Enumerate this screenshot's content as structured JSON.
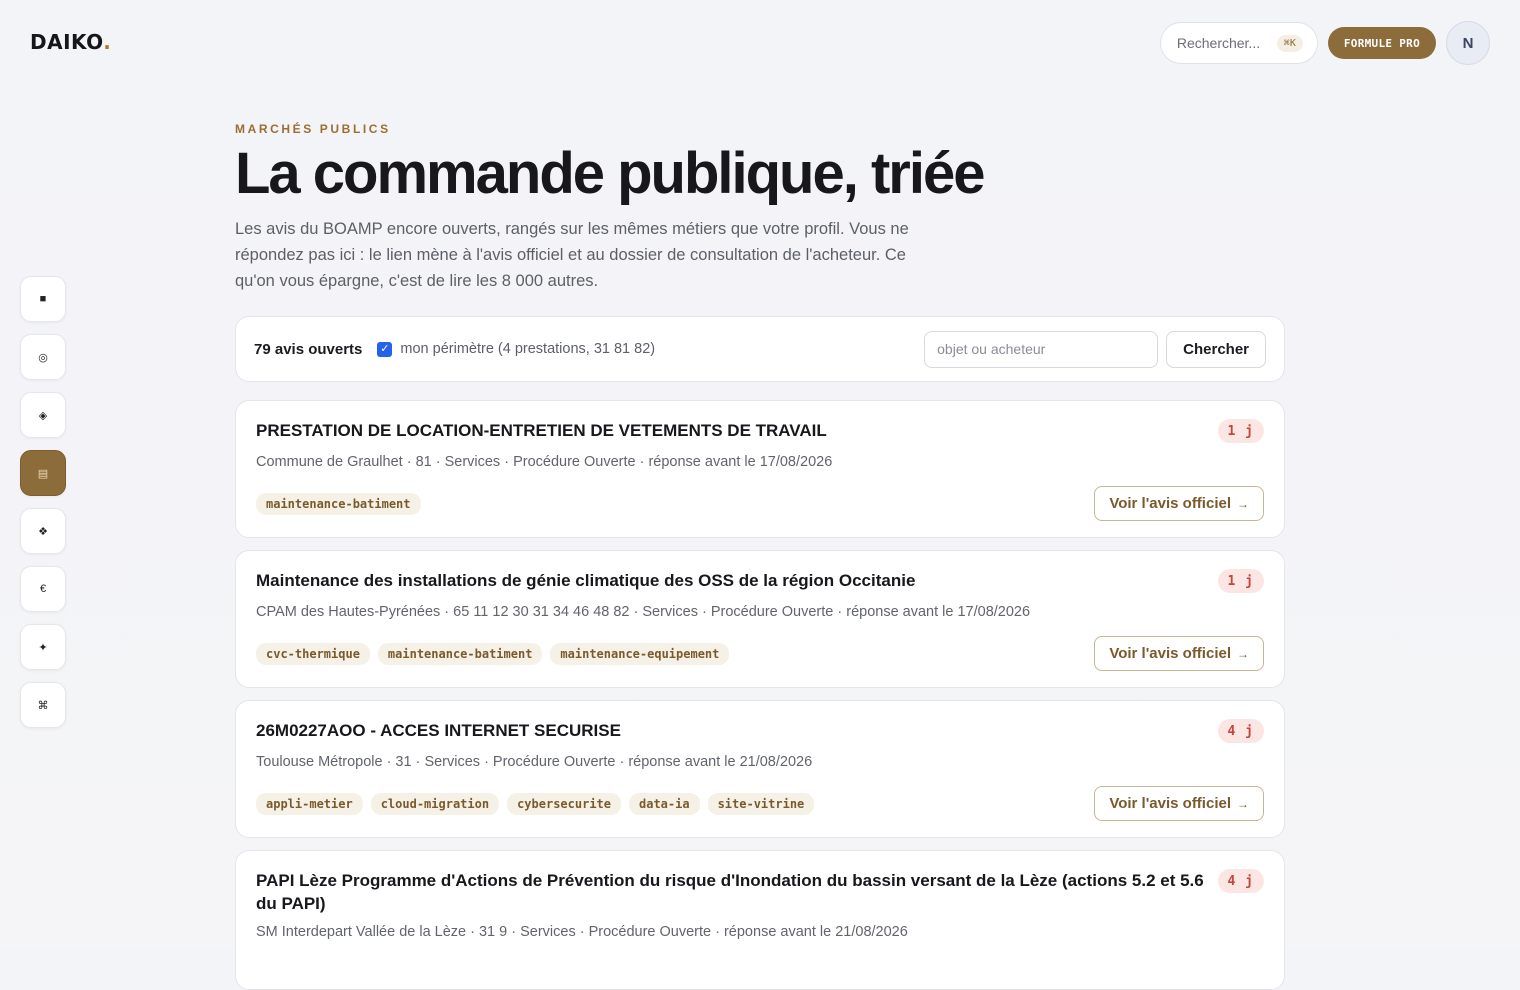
{
  "brand": {
    "name": "DAIKO",
    "dot": "."
  },
  "topbar": {
    "search_placeholder": "Rechercher...",
    "shortcut": "⌘K",
    "pro_label": "FORMULE PRO",
    "avatar_initial": "N"
  },
  "rail": {
    "items": [
      {
        "icon": "square-icon",
        "glyph": "■"
      },
      {
        "icon": "target-icon",
        "glyph": "◎"
      },
      {
        "icon": "diamond-icon",
        "glyph": "◈"
      },
      {
        "icon": "grid-icon",
        "glyph": "▤"
      },
      {
        "icon": "move-icon",
        "glyph": "❖"
      },
      {
        "icon": "euro-icon",
        "glyph": "€"
      },
      {
        "icon": "sparkle-icon",
        "glyph": "✦"
      },
      {
        "icon": "command-icon",
        "glyph": "⌘"
      }
    ],
    "active_index": 3
  },
  "hero": {
    "eyebrow": "MARCHÉS PUBLICS",
    "title": "La commande publique, triée",
    "lead": "Les avis du BOAMP encore ouverts, rangés sur les mêmes métiers que votre profil. Vous ne répondez pas ici : le lien mène à l'avis officiel et au dossier de consultation de l'acheteur. Ce qu'on vous épargne, c'est de lire les 8 000 autres."
  },
  "filter": {
    "count_label": "79 avis ouverts",
    "scope_checked": true,
    "scope_label": "mon périmètre (4 prestations, 31 81 82)",
    "input_placeholder": "objet ou acheteur",
    "search_label": "Chercher"
  },
  "cards": [
    {
      "title": "PRESTATION DE LOCATION-ENTRETIEN DE VETEMENTS DE TRAVAIL",
      "days": "1 j",
      "meta": "Commune de Graulhet · 81 · Services · Procédure Ouverte · réponse avant le 17/08/2026",
      "tags": [
        "maintenance-batiment"
      ],
      "action": "Voir l'avis officiel",
      "arrow": "→"
    },
    {
      "title": "Maintenance des installations de génie climatique des OSS de la région Occitanie",
      "days": "1 j",
      "meta": "CPAM des Hautes-Pyrénées · 65 11 12 30 31 34 46 48 82 · Services · Procédure Ouverte · réponse avant le 17/08/2026",
      "tags": [
        "cvc-thermique",
        "maintenance-batiment",
        "maintenance-equipement"
      ],
      "action": "Voir l'avis officiel",
      "arrow": "→"
    },
    {
      "title": "26M0227AOO - ACCES INTERNET SECURISE",
      "days": "4 j",
      "meta": "Toulouse Métropole · 31 · Services · Procédure Ouverte · réponse avant le 21/08/2026",
      "tags": [
        "appli-metier",
        "cloud-migration",
        "cybersecurite",
        "data-ia",
        "site-vitrine"
      ],
      "action": "Voir l'avis officiel",
      "arrow": "→"
    },
    {
      "title": "PAPI Lèze Programme d'Actions de Prévention du risque d'Inondation du bassin versant de la Lèze (actions 5.2 et 5.6 du PAPI)",
      "days": "4 j",
      "meta": "SM Interdepart Vallée de la Lèze · 31 9 · Services · Procédure Ouverte · réponse avant le 21/08/2026",
      "tags": [],
      "action": "",
      "arrow": ""
    }
  ]
}
